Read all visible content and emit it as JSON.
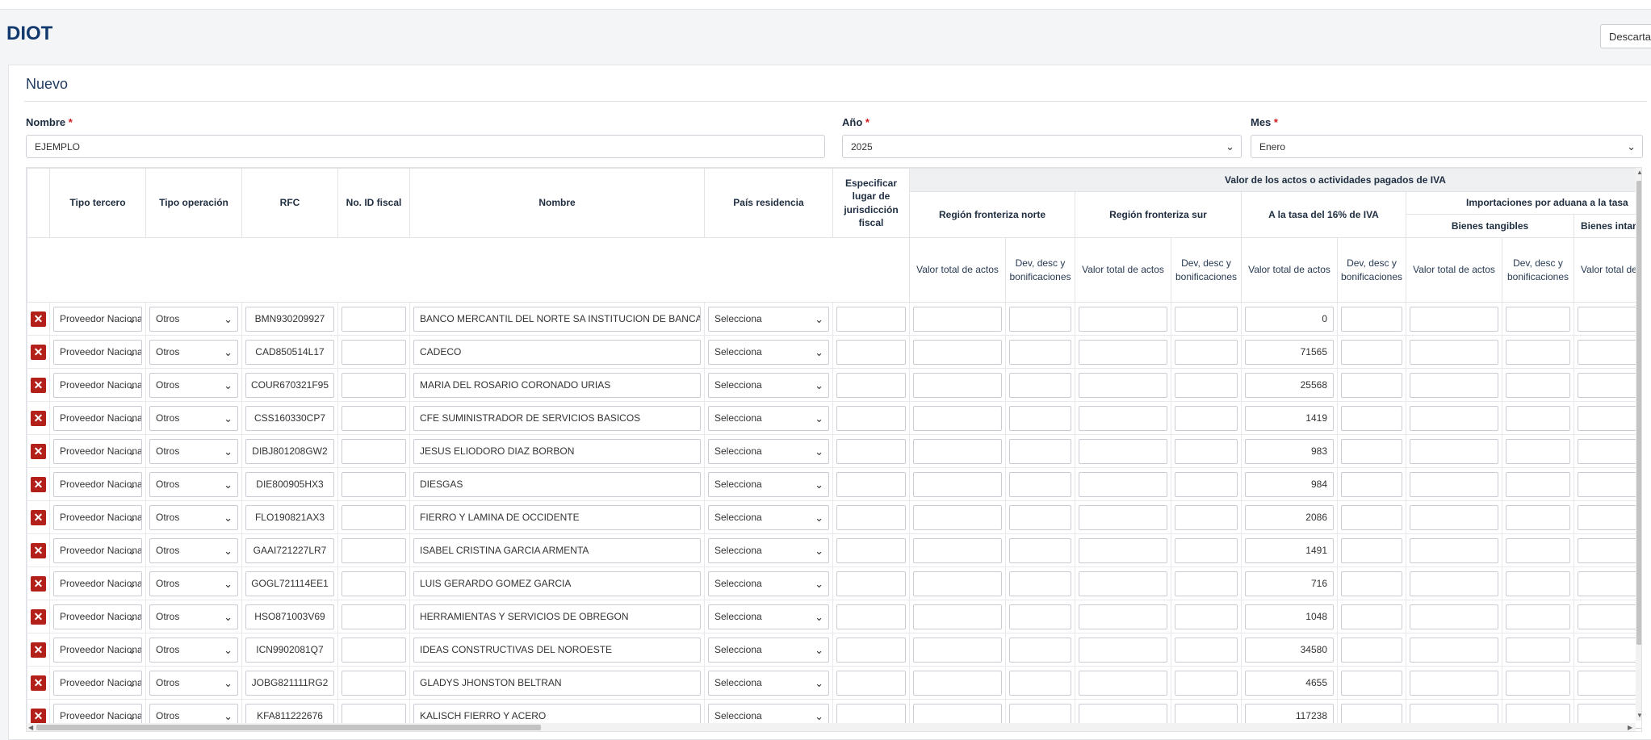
{
  "page": {
    "title": "DIOT",
    "discard_label": "Descartar"
  },
  "form": {
    "section_title": "Nuevo",
    "nombre_label": "Nombre",
    "nombre_value": "EJEMPLO",
    "anio_label": "Año",
    "anio_value": "2025",
    "mes_label": "Mes",
    "mes_value": "Enero",
    "required_mark": "*"
  },
  "table": {
    "headers": {
      "tipo_tercero": "Tipo tercero",
      "tipo_operacion": "Tipo operación",
      "rfc": "RFC",
      "id_fiscal": "No. ID fiscal",
      "nombre": "Nombre",
      "pais": "País residencia",
      "jurisdiccion": "Especificar lugar de jurisdicción fiscal",
      "group_main": "Valor de los actos o actividades pagados de IVA",
      "region_norte": "Región fronteriza norte",
      "region_sur": "Región fronteriza sur",
      "tasa16": "A la tasa del 16% de IVA",
      "importaciones": "Importaciones por aduana a la tasa",
      "bienes_tangibles": "Bienes tangibles",
      "bienes_intangibles": "Bienes intangibles",
      "valor_total": "Valor total de actos",
      "dev_desc": "Dev, desc y bonificaciones",
      "valor_total_cut": "Valor total de actos"
    },
    "tipo_tercero_value": "Proveedor Nacional",
    "tipo_operacion_value": "Otros",
    "pais_value": "Selecciona",
    "delete_glyph": "✕",
    "rows": [
      {
        "rfc": "BMN930209927",
        "nombre": "BANCO MERCANTIL DEL NORTE SA INSTITUCION DE BANCA MULTIPLE",
        "tasa16": "0"
      },
      {
        "rfc": "CAD850514L17",
        "nombre": "CADECO",
        "tasa16": "71565"
      },
      {
        "rfc": "COUR670321F95",
        "nombre": "MARIA DEL ROSARIO CORONADO URIAS",
        "tasa16": "25568"
      },
      {
        "rfc": "CSS160330CP7",
        "nombre": "CFE SUMINISTRADOR DE SERVICIOS BASICOS",
        "tasa16": "1419"
      },
      {
        "rfc": "DIBJ801208GW2",
        "nombre": "JESUS ELIODORO DIAZ BORBON",
        "tasa16": "983"
      },
      {
        "rfc": "DIE800905HX3",
        "nombre": "DIESGAS",
        "tasa16": "984"
      },
      {
        "rfc": "FLO190821AX3",
        "nombre": "FIERRO Y LAMINA DE OCCIDENTE",
        "tasa16": "2086"
      },
      {
        "rfc": "GAAI721227LR7",
        "nombre": "ISABEL CRISTINA GARCIA ARMENTA",
        "tasa16": "1491"
      },
      {
        "rfc": "GOGL721114EE1",
        "nombre": "LUIS GERARDO GOMEZ GARCIA",
        "tasa16": "716"
      },
      {
        "rfc": "HSO871003V69",
        "nombre": "HERRAMIENTAS Y SERVICIOS DE OBREGON",
        "tasa16": "1048"
      },
      {
        "rfc": "ICN9902081Q7",
        "nombre": "IDEAS CONSTRUCTIVAS DEL NOROESTE",
        "tasa16": "34580"
      },
      {
        "rfc": "JOBG821111RG2",
        "nombre": "GLADYS JHONSTON BELTRAN",
        "tasa16": "4655"
      },
      {
        "rfc": "KFA811222676",
        "nombre": "KALISCH FIERRO Y ACERO",
        "tasa16": "117238"
      }
    ]
  }
}
